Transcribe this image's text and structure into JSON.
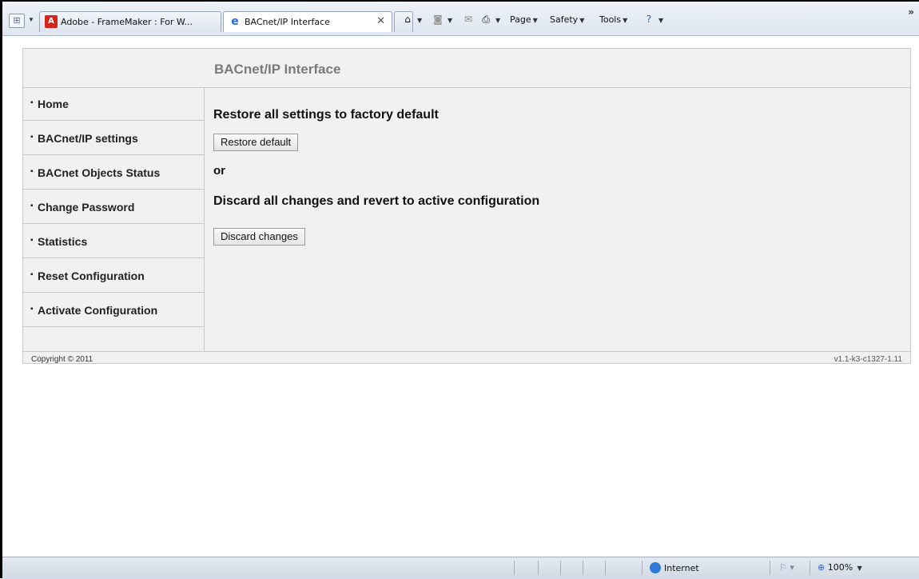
{
  "browser": {
    "tabs": [
      {
        "label": "Adobe - FrameMaker : For W...",
        "icon": "adobe-icon",
        "active": false
      },
      {
        "label": "BACnet/IP Interface",
        "icon": "ie-icon",
        "active": true
      }
    ],
    "commands": {
      "page": "Page",
      "safety": "Safety",
      "tools": "Tools"
    }
  },
  "page": {
    "title": "BACnet/IP Interface",
    "nav": [
      {
        "label": "Home"
      },
      {
        "label": "BACnet/IP settings"
      },
      {
        "label": "BACnet Objects Status"
      },
      {
        "label": "Change Password"
      },
      {
        "label": "Statistics"
      },
      {
        "label": "Reset Configuration"
      },
      {
        "label": "Activate Configuration"
      }
    ],
    "content": {
      "restore_heading": "Restore all settings to factory default",
      "restore_button": "Restore default",
      "or_text": "or",
      "discard_heading": "Discard all changes and revert to active configuration",
      "discard_button": "Discard changes"
    },
    "footer": {
      "copyright": "Copyright © 2011",
      "version": "v1.1-k3-c1327-1.11"
    }
  },
  "statusbar": {
    "zone": "Internet",
    "zoom": "100%"
  },
  "colors": {
    "page_bg": "#f1f1f1",
    "title_gray": "#7a7a7a",
    "border": "#c8c8c8"
  }
}
